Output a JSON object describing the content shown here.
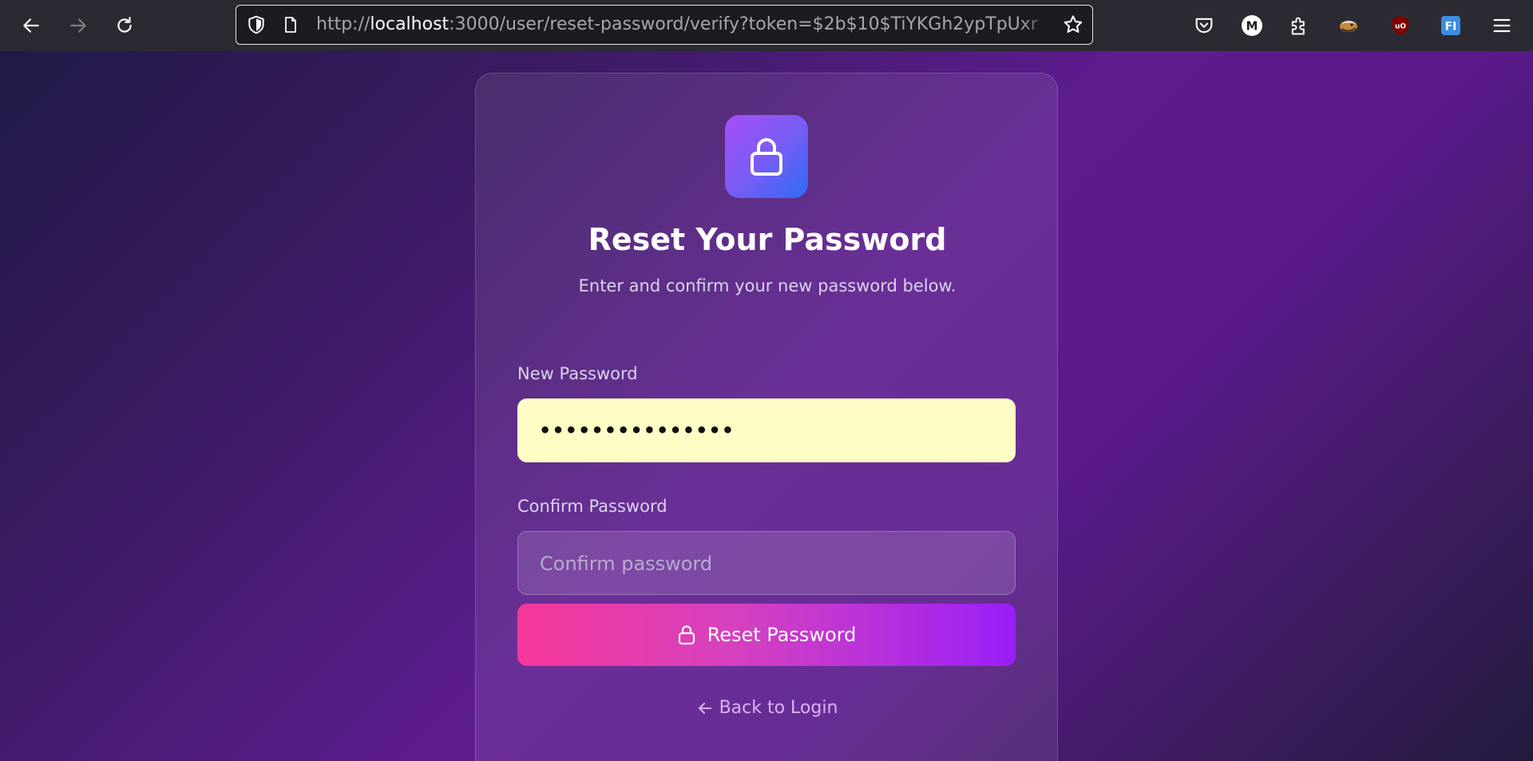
{
  "browser": {
    "url_prefix": "http://",
    "url_host": "localhost",
    "url_rest": ":3000/user/reset-password/verify?token=$2b$10$TiYKGh2ypTpUxr",
    "icons": {
      "back": "arrow-left-icon",
      "forward": "arrow-right-icon",
      "reload": "reload-icon",
      "shield": "shield-icon",
      "page": "page-icon",
      "bookmark": "star-icon",
      "pocket": "pocket-icon",
      "account": "m-avatar-icon",
      "extensions": "puzzle-icon",
      "ext_bird": "bird-extension-icon",
      "ext_ublock": "ublock-icon",
      "ext_fi": "fi-extension-icon",
      "menu": "hamburger-menu-icon"
    },
    "account_letter": "M",
    "ublock_text": "uO",
    "fi_text": "FI"
  },
  "form": {
    "title": "Reset Your Password",
    "subtitle": "Enter and confirm your new password below.",
    "new_password_label": "New Password",
    "new_password_value": "•••••••••••••••",
    "confirm_password_label": "Confirm Password",
    "confirm_password_placeholder": "Confirm password",
    "reset_button_label": "Reset Password",
    "back_link_label": "Back to Login"
  },
  "colors": {
    "accent_pink": "#f6389b",
    "accent_purple": "#9a1ff7",
    "autofill_yellow": "#fffdc6",
    "link": "#d8b4f4"
  }
}
